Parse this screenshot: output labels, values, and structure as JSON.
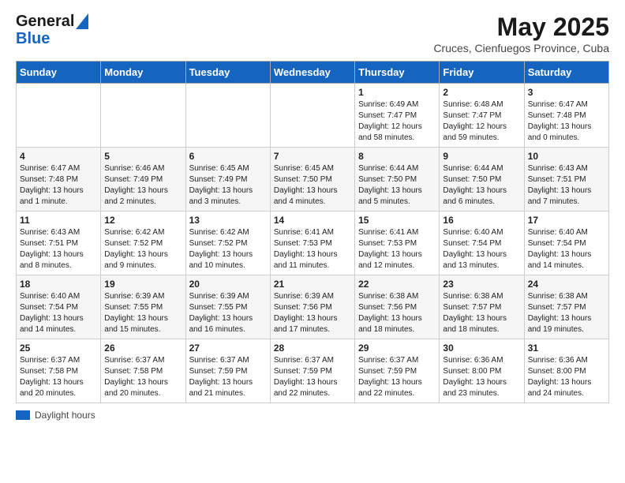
{
  "logo": {
    "line1": "General",
    "line2": "Blue"
  },
  "title": "May 2025",
  "subtitle": "Cruces, Cienfuegos Province, Cuba",
  "days_of_week": [
    "Sunday",
    "Monday",
    "Tuesday",
    "Wednesday",
    "Thursday",
    "Friday",
    "Saturday"
  ],
  "footer_label": "Daylight hours",
  "weeks": [
    [
      {
        "day": "",
        "info": ""
      },
      {
        "day": "",
        "info": ""
      },
      {
        "day": "",
        "info": ""
      },
      {
        "day": "",
        "info": ""
      },
      {
        "day": "1",
        "info": "Sunrise: 6:49 AM\nSunset: 7:47 PM\nDaylight: 12 hours\nand 58 minutes."
      },
      {
        "day": "2",
        "info": "Sunrise: 6:48 AM\nSunset: 7:47 PM\nDaylight: 12 hours\nand 59 minutes."
      },
      {
        "day": "3",
        "info": "Sunrise: 6:47 AM\nSunset: 7:48 PM\nDaylight: 13 hours\nand 0 minutes."
      }
    ],
    [
      {
        "day": "4",
        "info": "Sunrise: 6:47 AM\nSunset: 7:48 PM\nDaylight: 13 hours\nand 1 minute."
      },
      {
        "day": "5",
        "info": "Sunrise: 6:46 AM\nSunset: 7:49 PM\nDaylight: 13 hours\nand 2 minutes."
      },
      {
        "day": "6",
        "info": "Sunrise: 6:45 AM\nSunset: 7:49 PM\nDaylight: 13 hours\nand 3 minutes."
      },
      {
        "day": "7",
        "info": "Sunrise: 6:45 AM\nSunset: 7:50 PM\nDaylight: 13 hours\nand 4 minutes."
      },
      {
        "day": "8",
        "info": "Sunrise: 6:44 AM\nSunset: 7:50 PM\nDaylight: 13 hours\nand 5 minutes."
      },
      {
        "day": "9",
        "info": "Sunrise: 6:44 AM\nSunset: 7:50 PM\nDaylight: 13 hours\nand 6 minutes."
      },
      {
        "day": "10",
        "info": "Sunrise: 6:43 AM\nSunset: 7:51 PM\nDaylight: 13 hours\nand 7 minutes."
      }
    ],
    [
      {
        "day": "11",
        "info": "Sunrise: 6:43 AM\nSunset: 7:51 PM\nDaylight: 13 hours\nand 8 minutes."
      },
      {
        "day": "12",
        "info": "Sunrise: 6:42 AM\nSunset: 7:52 PM\nDaylight: 13 hours\nand 9 minutes."
      },
      {
        "day": "13",
        "info": "Sunrise: 6:42 AM\nSunset: 7:52 PM\nDaylight: 13 hours\nand 10 minutes."
      },
      {
        "day": "14",
        "info": "Sunrise: 6:41 AM\nSunset: 7:53 PM\nDaylight: 13 hours\nand 11 minutes."
      },
      {
        "day": "15",
        "info": "Sunrise: 6:41 AM\nSunset: 7:53 PM\nDaylight: 13 hours\nand 12 minutes."
      },
      {
        "day": "16",
        "info": "Sunrise: 6:40 AM\nSunset: 7:54 PM\nDaylight: 13 hours\nand 13 minutes."
      },
      {
        "day": "17",
        "info": "Sunrise: 6:40 AM\nSunset: 7:54 PM\nDaylight: 13 hours\nand 14 minutes."
      }
    ],
    [
      {
        "day": "18",
        "info": "Sunrise: 6:40 AM\nSunset: 7:54 PM\nDaylight: 13 hours\nand 14 minutes."
      },
      {
        "day": "19",
        "info": "Sunrise: 6:39 AM\nSunset: 7:55 PM\nDaylight: 13 hours\nand 15 minutes."
      },
      {
        "day": "20",
        "info": "Sunrise: 6:39 AM\nSunset: 7:55 PM\nDaylight: 13 hours\nand 16 minutes."
      },
      {
        "day": "21",
        "info": "Sunrise: 6:39 AM\nSunset: 7:56 PM\nDaylight: 13 hours\nand 17 minutes."
      },
      {
        "day": "22",
        "info": "Sunrise: 6:38 AM\nSunset: 7:56 PM\nDaylight: 13 hours\nand 18 minutes."
      },
      {
        "day": "23",
        "info": "Sunrise: 6:38 AM\nSunset: 7:57 PM\nDaylight: 13 hours\nand 18 minutes."
      },
      {
        "day": "24",
        "info": "Sunrise: 6:38 AM\nSunset: 7:57 PM\nDaylight: 13 hours\nand 19 minutes."
      }
    ],
    [
      {
        "day": "25",
        "info": "Sunrise: 6:37 AM\nSunset: 7:58 PM\nDaylight: 13 hours\nand 20 minutes."
      },
      {
        "day": "26",
        "info": "Sunrise: 6:37 AM\nSunset: 7:58 PM\nDaylight: 13 hours\nand 20 minutes."
      },
      {
        "day": "27",
        "info": "Sunrise: 6:37 AM\nSunset: 7:59 PM\nDaylight: 13 hours\nand 21 minutes."
      },
      {
        "day": "28",
        "info": "Sunrise: 6:37 AM\nSunset: 7:59 PM\nDaylight: 13 hours\nand 22 minutes."
      },
      {
        "day": "29",
        "info": "Sunrise: 6:37 AM\nSunset: 7:59 PM\nDaylight: 13 hours\nand 22 minutes."
      },
      {
        "day": "30",
        "info": "Sunrise: 6:36 AM\nSunset: 8:00 PM\nDaylight: 13 hours\nand 23 minutes."
      },
      {
        "day": "31",
        "info": "Sunrise: 6:36 AM\nSunset: 8:00 PM\nDaylight: 13 hours\nand 24 minutes."
      }
    ]
  ]
}
